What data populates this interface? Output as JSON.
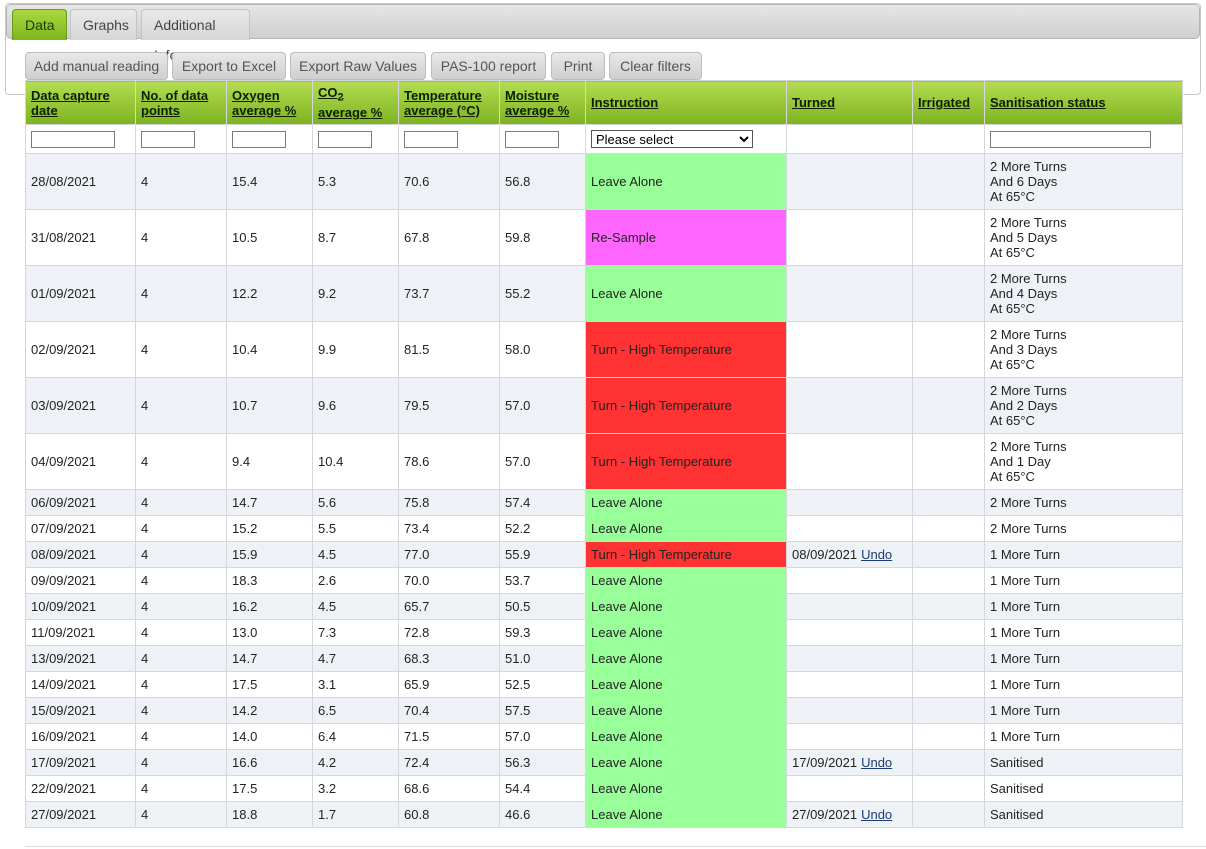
{
  "tabs": [
    {
      "label": "Data",
      "active": true
    },
    {
      "label": "Graphs",
      "active": false
    },
    {
      "label": "Additional Info",
      "active": false
    }
  ],
  "toolbar": {
    "add_manual_reading": "Add manual reading",
    "export_excel": "Export to Excel",
    "export_raw": "Export Raw Values",
    "pas100": "PAS-100 report",
    "print": "Print",
    "clear_filters": "Clear filters"
  },
  "table": {
    "headers": {
      "date": "Data capture date",
      "points": "No. of data points",
      "oxygen": "Oxygen average %",
      "co2_prefix": "CO",
      "co2_sub": "2",
      "co2_suffix": "average %",
      "temperature": "Temperature average (°C)",
      "moisture": "Moisture average %",
      "instruction": "Instruction",
      "turned": "Turned",
      "irrigated": "Irrigated",
      "sanitisation": "Sanitisation status"
    },
    "instruction_filter": "Please select",
    "undo_label": "Undo",
    "instruction_colors": {
      "Leave Alone": "#99ff99",
      "Re-Sample": "#ff66ff",
      "Turn - High Temperature": "#ff3333"
    },
    "rows": [
      {
        "date": "28/08/2021",
        "points": "4",
        "oxygen": "15.4",
        "co2": "5.3",
        "temp": "70.6",
        "moisture": "56.8",
        "instruction": "Leave Alone",
        "turned": "",
        "irrigated": "",
        "status": "2 More Turns\nAnd 6 Days\nAt 65°C"
      },
      {
        "date": "31/08/2021",
        "points": "4",
        "oxygen": "10.5",
        "co2": "8.7",
        "temp": "67.8",
        "moisture": "59.8",
        "instruction": "Re-Sample",
        "turned": "",
        "irrigated": "",
        "status": "2 More Turns\nAnd 5 Days\nAt 65°C"
      },
      {
        "date": "01/09/2021",
        "points": "4",
        "oxygen": "12.2",
        "co2": "9.2",
        "temp": "73.7",
        "moisture": "55.2",
        "instruction": "Leave Alone",
        "turned": "",
        "irrigated": "",
        "status": "2 More Turns\nAnd 4 Days\nAt 65°C"
      },
      {
        "date": "02/09/2021",
        "points": "4",
        "oxygen": "10.4",
        "co2": "9.9",
        "temp": "81.5",
        "moisture": "58.0",
        "instruction": "Turn - High Temperature",
        "turned": "",
        "irrigated": "",
        "status": "2 More Turns\nAnd 3 Days\nAt 65°C"
      },
      {
        "date": "03/09/2021",
        "points": "4",
        "oxygen": "10.7",
        "co2": "9.6",
        "temp": "79.5",
        "moisture": "57.0",
        "instruction": "Turn - High Temperature",
        "turned": "",
        "irrigated": "",
        "status": "2 More Turns\nAnd 2 Days\nAt 65°C"
      },
      {
        "date": "04/09/2021",
        "points": "4",
        "oxygen": "9.4",
        "co2": "10.4",
        "temp": "78.6",
        "moisture": "57.0",
        "instruction": "Turn - High Temperature",
        "turned": "",
        "irrigated": "",
        "status": "2 More Turns\nAnd 1 Day\nAt 65°C"
      },
      {
        "date": "06/09/2021",
        "points": "4",
        "oxygen": "14.7",
        "co2": "5.6",
        "temp": "75.8",
        "moisture": "57.4",
        "instruction": "Leave Alone",
        "turned": "",
        "irrigated": "",
        "status": "2 More Turns"
      },
      {
        "date": "07/09/2021",
        "points": "4",
        "oxygen": "15.2",
        "co2": "5.5",
        "temp": "73.4",
        "moisture": "52.2",
        "instruction": "Leave Alone",
        "turned": "",
        "irrigated": "",
        "status": "2 More Turns"
      },
      {
        "date": "08/09/2021",
        "points": "4",
        "oxygen": "15.9",
        "co2": "4.5",
        "temp": "77.0",
        "moisture": "55.9",
        "instruction": "Turn - High Temperature",
        "turned": "08/09/2021",
        "irrigated": "",
        "status": "1 More Turn"
      },
      {
        "date": "09/09/2021",
        "points": "4",
        "oxygen": "18.3",
        "co2": "2.6",
        "temp": "70.0",
        "moisture": "53.7",
        "instruction": "Leave Alone",
        "turned": "",
        "irrigated": "",
        "status": "1 More Turn"
      },
      {
        "date": "10/09/2021",
        "points": "4",
        "oxygen": "16.2",
        "co2": "4.5",
        "temp": "65.7",
        "moisture": "50.5",
        "instruction": "Leave Alone",
        "turned": "",
        "irrigated": "",
        "status": "1 More Turn"
      },
      {
        "date": "11/09/2021",
        "points": "4",
        "oxygen": "13.0",
        "co2": "7.3",
        "temp": "72.8",
        "moisture": "59.3",
        "instruction": "Leave Alone",
        "turned": "",
        "irrigated": "",
        "status": "1 More Turn"
      },
      {
        "date": "13/09/2021",
        "points": "4",
        "oxygen": "14.7",
        "co2": "4.7",
        "temp": "68.3",
        "moisture": "51.0",
        "instruction": "Leave Alone",
        "turned": "",
        "irrigated": "",
        "status": "1 More Turn"
      },
      {
        "date": "14/09/2021",
        "points": "4",
        "oxygen": "17.5",
        "co2": "3.1",
        "temp": "65.9",
        "moisture": "52.5",
        "instruction": "Leave Alone",
        "turned": "",
        "irrigated": "",
        "status": "1 More Turn"
      },
      {
        "date": "15/09/2021",
        "points": "4",
        "oxygen": "14.2",
        "co2": "6.5",
        "temp": "70.4",
        "moisture": "57.5",
        "instruction": "Leave Alone",
        "turned": "",
        "irrigated": "",
        "status": "1 More Turn"
      },
      {
        "date": "16/09/2021",
        "points": "4",
        "oxygen": "14.0",
        "co2": "6.4",
        "temp": "71.5",
        "moisture": "57.0",
        "instruction": "Leave Alone",
        "turned": "",
        "irrigated": "",
        "status": "1 More Turn"
      },
      {
        "date": "17/09/2021",
        "points": "4",
        "oxygen": "16.6",
        "co2": "4.2",
        "temp": "72.4",
        "moisture": "56.3",
        "instruction": "Leave Alone",
        "turned": "17/09/2021",
        "irrigated": "",
        "status": "Sanitised"
      },
      {
        "date": "22/09/2021",
        "points": "4",
        "oxygen": "17.5",
        "co2": "3.2",
        "temp": "68.6",
        "moisture": "54.4",
        "instruction": "Leave Alone",
        "turned": "",
        "irrigated": "",
        "status": "Sanitised"
      },
      {
        "date": "27/09/2021",
        "points": "4",
        "oxygen": "18.8",
        "co2": "1.7",
        "temp": "60.8",
        "moisture": "46.6",
        "instruction": "Leave Alone",
        "turned": "27/09/2021",
        "irrigated": "",
        "status": "Sanitised"
      }
    ]
  }
}
